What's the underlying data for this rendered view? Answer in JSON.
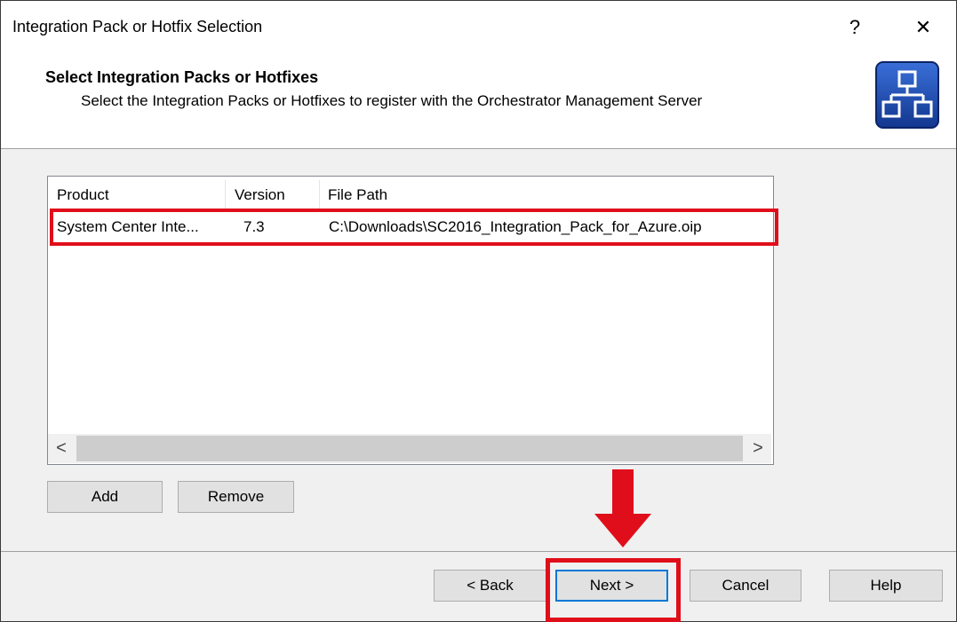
{
  "window": {
    "title": "Integration Pack or Hotfix Selection",
    "help_glyph": "?",
    "close_glyph": "✕"
  },
  "header": {
    "title": "Select Integration Packs or Hotfixes",
    "subtitle": "Select the Integration Packs or Hotfixes to register with the Orchestrator Management Server",
    "icon": "hierarchy-diagram-icon"
  },
  "list": {
    "columns": [
      "Product",
      "Version",
      "File Path"
    ],
    "rows": [
      {
        "product": "System Center Inte...",
        "version": "7.3",
        "file_path": "C:\\Downloads\\SC2016_Integration_Pack_for_Azure.oip"
      }
    ],
    "scroll_left": "<",
    "scroll_right": ">"
  },
  "buttons": {
    "add": "Add",
    "remove": "Remove",
    "back": "< Back",
    "next": "Next >",
    "cancel": "Cancel",
    "help": "Help"
  },
  "colors": {
    "highlight": "#e00e1a",
    "focus_border": "#0078d7",
    "icon_blue": "#1d4fb3"
  }
}
